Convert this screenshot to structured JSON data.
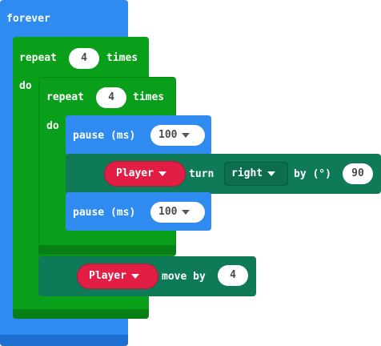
{
  "blocks": {
    "forever": {
      "label": "forever"
    },
    "outer_repeat": {
      "label_repeat": "repeat",
      "count": "4",
      "label_times": "times",
      "label_do": "do"
    },
    "inner_repeat": {
      "label_repeat": "repeat",
      "count": "4",
      "label_times": "times",
      "label_do": "do"
    },
    "pause1": {
      "label": "pause (ms)",
      "value": "100"
    },
    "turn": {
      "sprite": "Player",
      "label_turn": "turn",
      "direction": "right",
      "label_by": "by (°)",
      "degrees": "90"
    },
    "pause2": {
      "label": "pause (ms)",
      "value": "100"
    },
    "move": {
      "sprite": "Player",
      "label": "move by",
      "steps": "4"
    }
  },
  "colors": {
    "loops_blue": "#2f8bf0",
    "loops_green": "#0a9f1a",
    "sprites_teal": "#0f7a57",
    "sprite_var_red": "#e21e45"
  }
}
